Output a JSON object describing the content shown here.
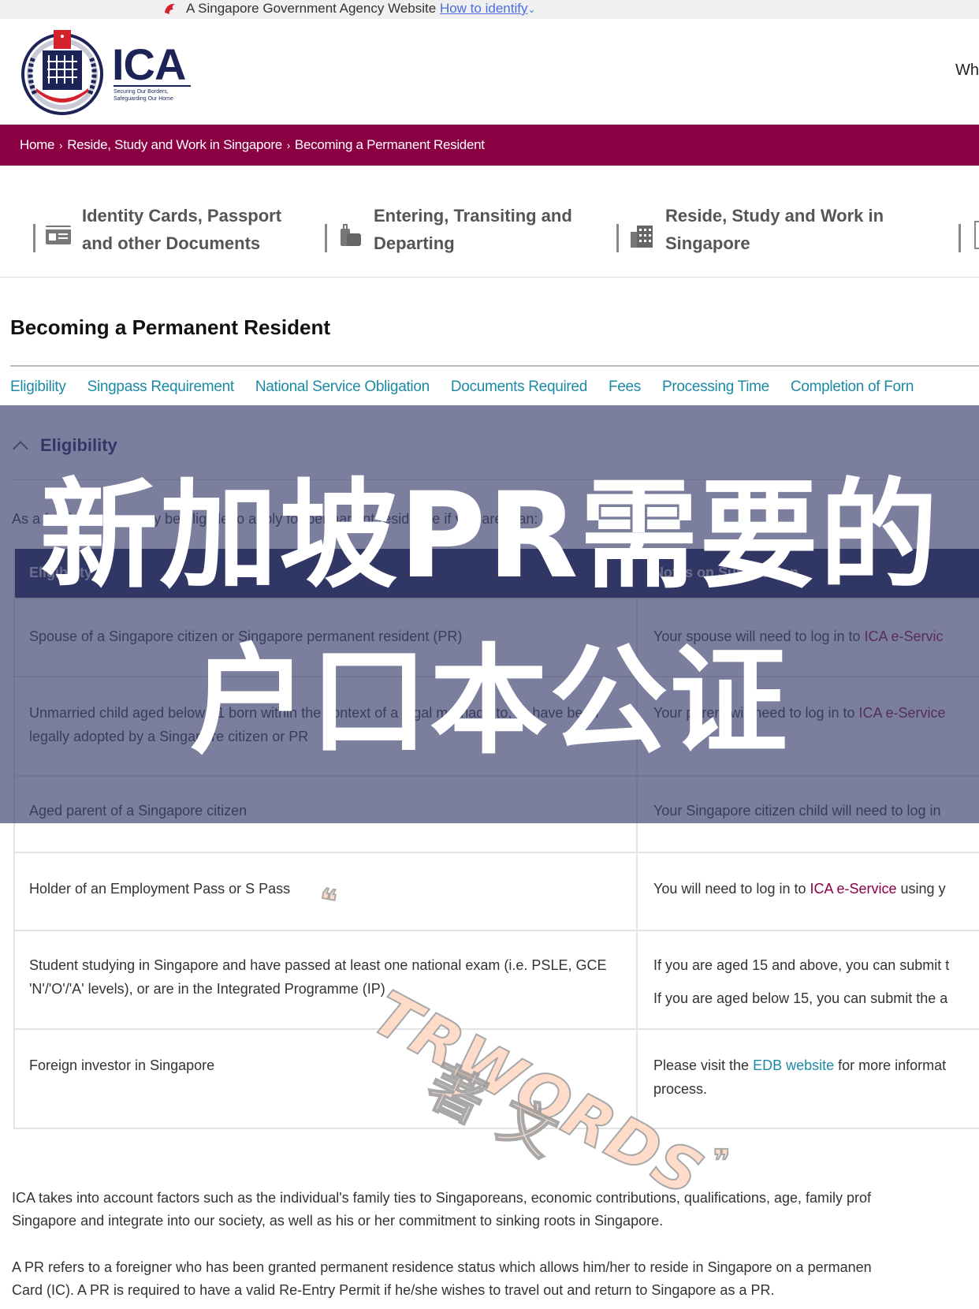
{
  "masthead": {
    "text": "A Singapore Government Agency Website",
    "link": "How to identify",
    "chevron": "⌄"
  },
  "header": {
    "logo_text": "ICA",
    "tagline_1": "Securing Our Borders,",
    "tagline_2": "Safeguarding Our Home",
    "right_text": "Wh"
  },
  "breadcrumb": {
    "items": [
      "Home",
      "Reside, Study and Work in Singapore",
      "Becoming a Permanent Resident"
    ],
    "separator": "›"
  },
  "topnav": {
    "items": [
      {
        "label": "Identity Cards, Passport and other Documents",
        "icon": "id-card-icon"
      },
      {
        "label": "Entering, Transiting and Departing",
        "icon": "luggage-icon"
      },
      {
        "label": "Reside, Study and Work in Singapore",
        "icon": "building-icon"
      }
    ]
  },
  "page": {
    "title": "Becoming a Permanent Resident",
    "anchors": [
      "Eligibility",
      "Singpass Requirement",
      "National Service Obligation",
      "Documents Required",
      "Fees",
      "Processing Time",
      "Completion of Forn"
    ],
    "accordion_title": "Eligibility",
    "intro": "As a foreigner, you may be eligible to apply for permanent residence if you are a/an:"
  },
  "table": {
    "headers": [
      "Eligibility",
      "Notes on Submission"
    ],
    "rows": [
      {
        "c1": "Spouse of a Singapore citizen or Singapore permanent resident (PR)",
        "c2_pre": "Your spouse will need to log in to ",
        "c2_link": "ICA e-Servic",
        "c2_post": ""
      },
      {
        "c1": "Unmarried child aged below 21 born within the context of a legal marriage to, or have been legally adopted by a Singapore citizen or PR",
        "c2_pre": "Your parent will need to log in to ",
        "c2_link": "ICA e-Service",
        "c2_post": ""
      },
      {
        "c1": "Aged parent of a Singapore citizen",
        "c2_pre": "Your Singapore citizen child will need to log in",
        "c2_link": "",
        "c2_post": ""
      },
      {
        "c1": "Holder of an Employment Pass or S Pass",
        "c2_pre": "You will need to log in to ",
        "c2_link": "ICA e-Service",
        "c2_post": " using y"
      },
      {
        "c1": "Student studying in Singapore and have passed at least one national exam (i.e. PSLE, GCE 'N'/'O'/'A' levels), or are in the Integrated Programme (IP)",
        "c2_pre": "If you are aged 15 and above, you can submit t",
        "c2_line2": "If you are aged below 15, you can submit the a",
        "c2_link": "",
        "c2_post": ""
      },
      {
        "c1": "Foreign investor in Singapore",
        "c2_pre": "Please visit the ",
        "c2_link": "EDB website",
        "c2_post": " for more informat",
        "c2_line2": "process."
      }
    ]
  },
  "paragraphs": [
    {
      "line1": "ICA takes into account factors such as the individual's family ties to Singaporeans, economic contributions, qualifications, age, family prof",
      "line2": "Singapore and integrate into our society, as well as his or her commitment to sinking roots in Singapore."
    },
    {
      "line1": "A PR refers to a foreigner who has been granted permanent residence status which allows him/her to reside in Singapore on a permanen",
      "line2": "Card (IC). A PR is required to have a valid Re-Entry Permit if he/she wishes to travel out and return to Singapore as a PR."
    }
  ],
  "overlay": {
    "line1": "新加坡PR需要的",
    "line2": "户口本公证"
  },
  "watermark": {
    "brand": "TRWORDS",
    "cn": "著文",
    "open_quote": "❝",
    "close_quote": "❞"
  },
  "colors": {
    "brand_maroon": "#8b0043",
    "navy": "#1b2357",
    "teal_link": "#1d8aa5"
  }
}
